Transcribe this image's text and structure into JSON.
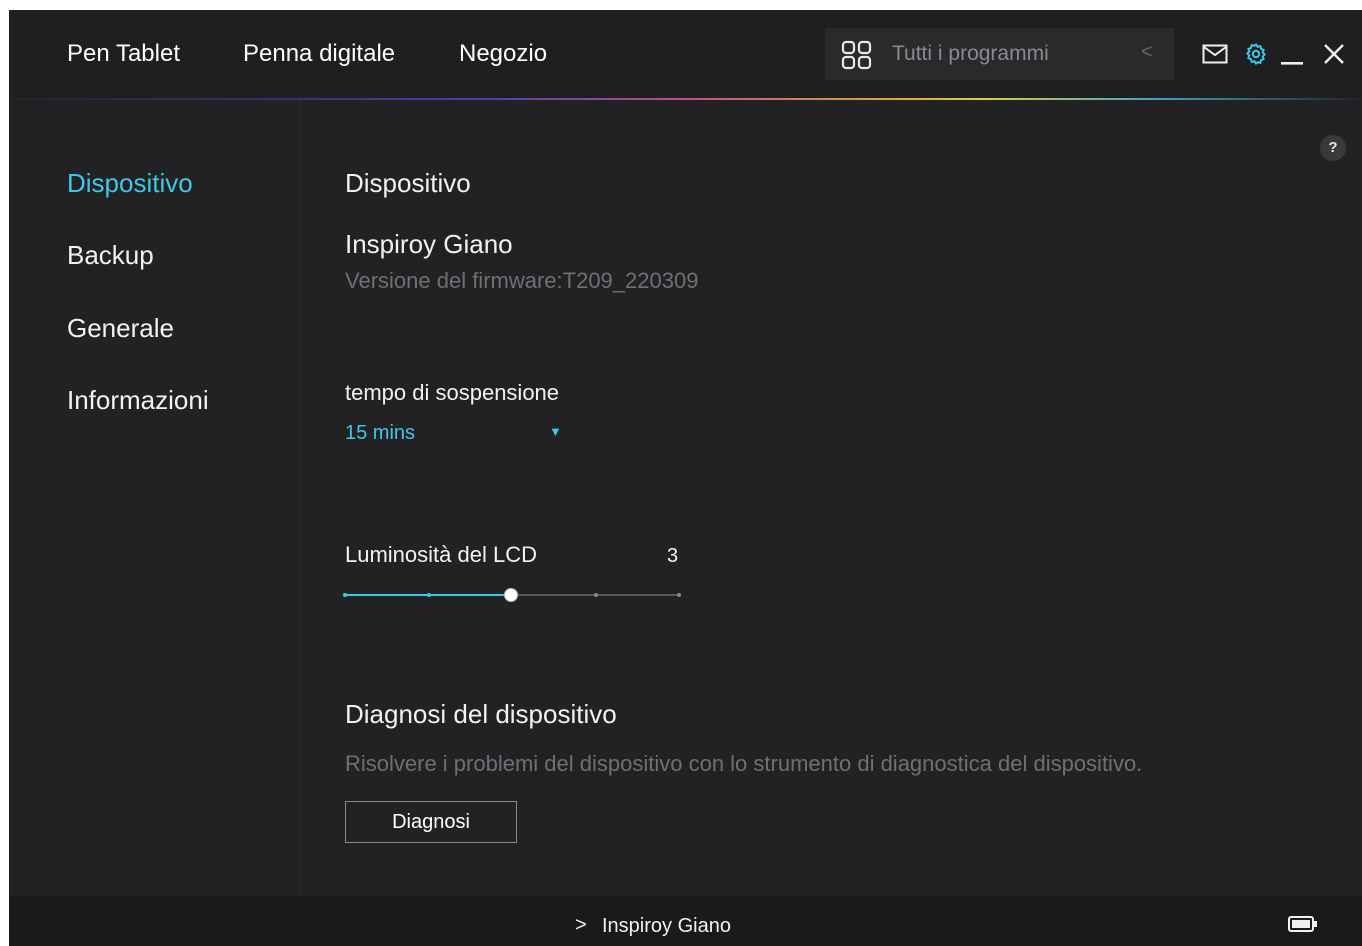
{
  "topbar": {
    "nav": [
      "Pen Tablet",
      "Penna digitale",
      "Negozio"
    ],
    "programs_label": "Tutti i programmi",
    "programs_chevron": "<",
    "icons": [
      "grid-icon",
      "mail-icon",
      "gear-icon",
      "minimize-icon",
      "close-icon"
    ]
  },
  "sidebar": {
    "items": [
      {
        "label": "Dispositivo",
        "active": true
      },
      {
        "label": "Backup",
        "active": false
      },
      {
        "label": "Generale",
        "active": false
      },
      {
        "label": "Informazioni",
        "active": false
      }
    ]
  },
  "main": {
    "help_label": "?",
    "section_title": "Dispositivo",
    "device_name": "Inspiroy Giano",
    "firmware": "Versione del firmware:T209_220309",
    "sleep": {
      "label": "tempo di sospensione",
      "value": "15 mins"
    },
    "brightness": {
      "label": "Luminosità del LCD",
      "value": "3",
      "level": 3,
      "min": 1,
      "max": 5
    },
    "diagnosis": {
      "title": "Diagnosi del dispositivo",
      "description": "Risolvere i problemi del dispositivo con lo strumento di diagnostica del dispositivo.",
      "button": "Diagnosi"
    }
  },
  "bottombar": {
    "chevron": ">",
    "device": "Inspiroy Giano",
    "battery_icon": "battery-icon"
  },
  "colors": {
    "accent": "#3ec8e6",
    "background": "#222224",
    "topbar": "#1f1f21",
    "bottombar": "#1a1a1c"
  }
}
